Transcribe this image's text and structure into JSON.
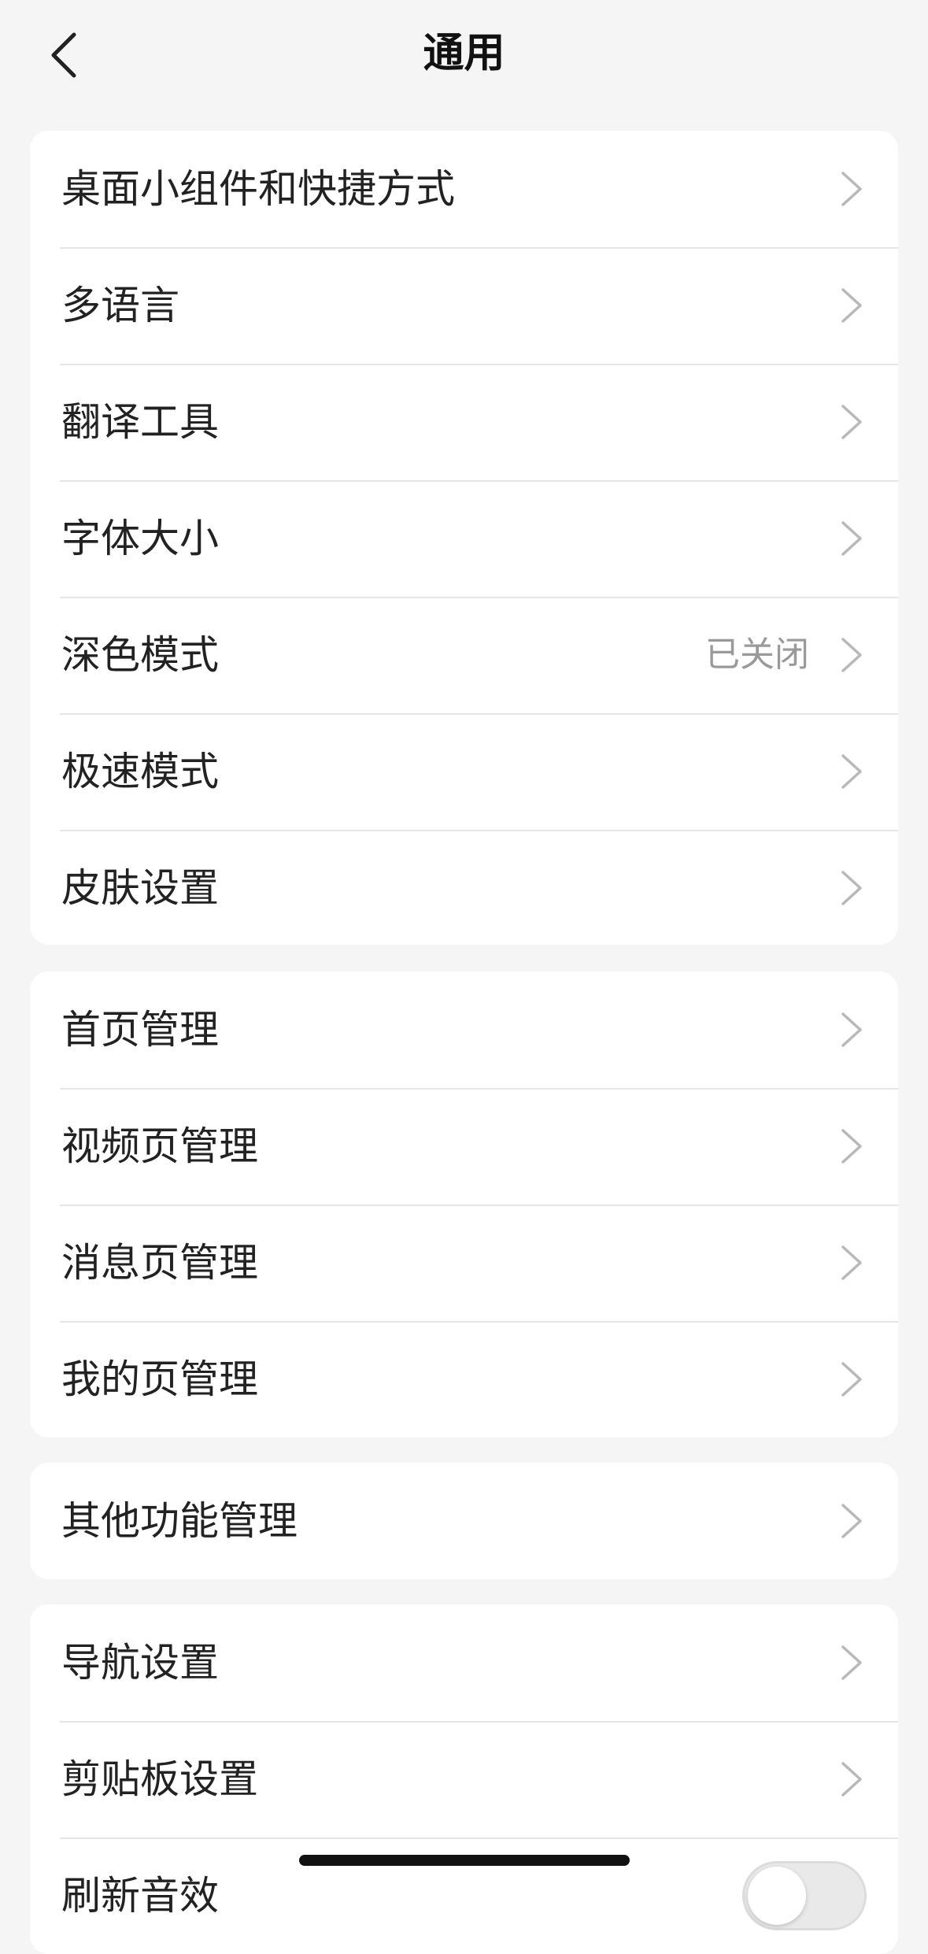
{
  "header": {
    "title": "通用"
  },
  "groups": [
    {
      "items": [
        {
          "label": "桌面小组件和快捷方式"
        },
        {
          "label": "多语言"
        },
        {
          "label": "翻译工具"
        },
        {
          "label": "字体大小"
        },
        {
          "label": "深色模式",
          "value": "已关闭"
        },
        {
          "label": "极速模式"
        },
        {
          "label": "皮肤设置"
        }
      ]
    },
    {
      "items": [
        {
          "label": "首页管理"
        },
        {
          "label": "视频页管理"
        },
        {
          "label": "消息页管理"
        },
        {
          "label": "我的页管理"
        }
      ]
    },
    {
      "items": [
        {
          "label": "其他功能管理"
        }
      ]
    },
    {
      "items": [
        {
          "label": "导航设置"
        },
        {
          "label": "剪贴板设置"
        },
        {
          "label": "刷新音效",
          "toggle": false
        }
      ]
    }
  ],
  "icons": {
    "back": "chevron-left-icon",
    "row_arrow": "chevron-right-icon"
  },
  "colors": {
    "background": "#f5f5f5",
    "card": "#ffffff",
    "text": "#222222",
    "secondary_text": "#9a9a9a",
    "separator": "#e6e6e6",
    "chevron": "#b8b8b8"
  }
}
